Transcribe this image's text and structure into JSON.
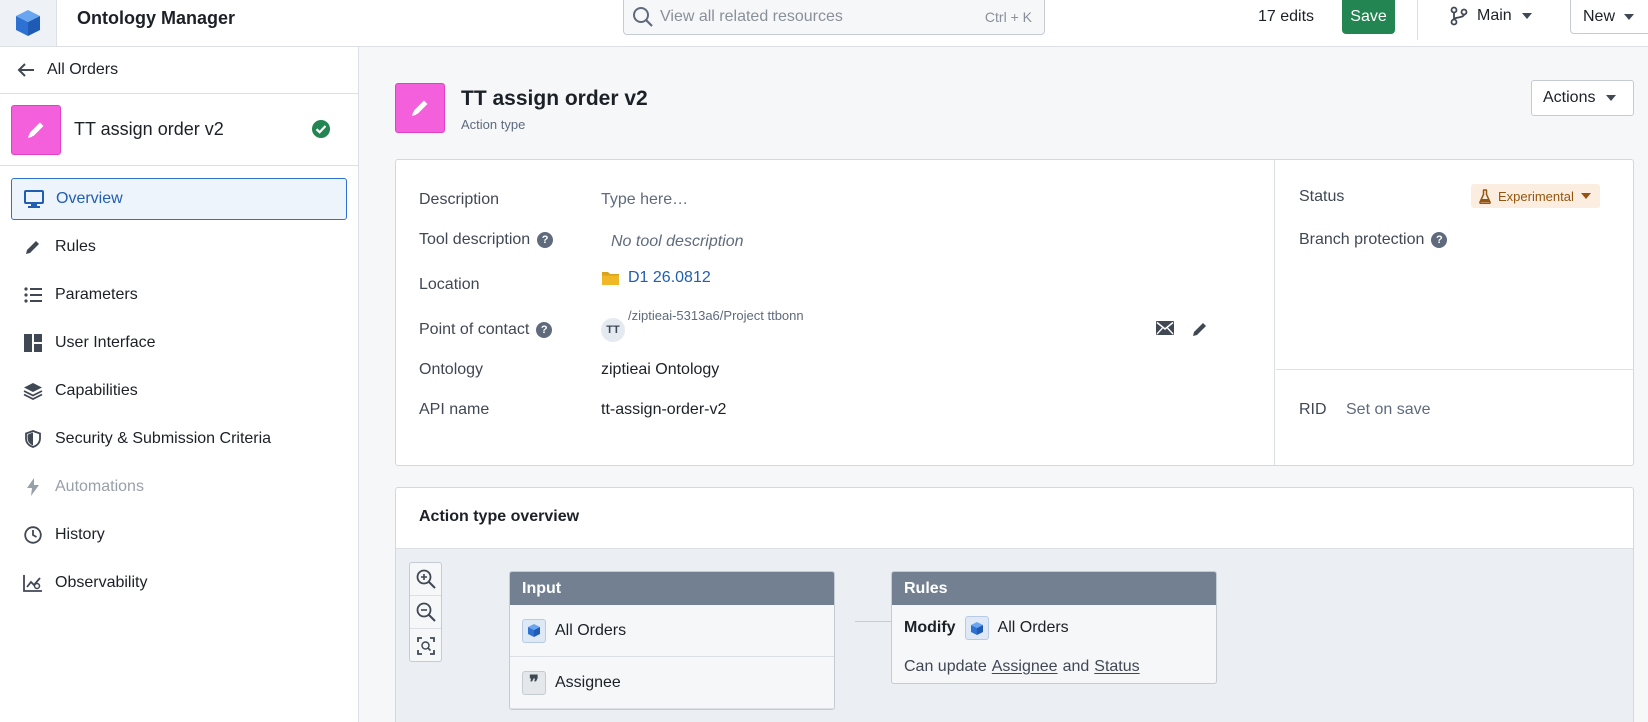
{
  "app": {
    "title": "Ontology Manager",
    "logo_icon": "cube-icon"
  },
  "topbar": {
    "search_placeholder": "View all related resources",
    "search_shortcut": "Ctrl + K",
    "edits": "17 edits",
    "save_label": "Save",
    "branch": "Main",
    "new_label": "New"
  },
  "sidebar": {
    "back_label": "All Orders",
    "entity_name": "TT assign order v2",
    "items": [
      {
        "label": "Overview",
        "icon": "monitor-icon"
      },
      {
        "label": "Rules",
        "icon": "pencil-icon"
      },
      {
        "label": "Parameters",
        "icon": "list-icon"
      },
      {
        "label": "User Interface",
        "icon": "layout-icon"
      },
      {
        "label": "Capabilities",
        "icon": "layers-icon"
      },
      {
        "label": "Security & Submission Criteria",
        "icon": "shield-icon"
      },
      {
        "label": "Automations",
        "icon": "lightning-icon"
      },
      {
        "label": "History",
        "icon": "clock-icon"
      },
      {
        "label": "Observability",
        "icon": "chart-icon"
      }
    ]
  },
  "header": {
    "title": "TT assign order v2",
    "subtitle": "Action type",
    "actions_label": "Actions"
  },
  "properties": {
    "description_label": "Description",
    "description_placeholder": "Type here…",
    "tool_description_label": "Tool description",
    "tool_description_value": "No tool description",
    "location_label": "Location",
    "location_name": "D1 26.0812",
    "location_path": "/ziptieai-5313a6/Project ttbonn",
    "poc_label": "Point of contact",
    "poc_initials": "TT",
    "ontology_label": "Ontology",
    "ontology_value": "ziptieai Ontology",
    "api_label": "API name",
    "api_value": "tt-assign-order-v2"
  },
  "meta": {
    "status_label": "Status",
    "status_value": "Experimental",
    "status_color": "#935610",
    "branch_protection_label": "Branch protection",
    "rid_label": "RID",
    "rid_value": "Set on save"
  },
  "overview": {
    "title": "Action type overview",
    "input_node": {
      "title": "Input",
      "rows": [
        "All Orders",
        "Assignee"
      ]
    },
    "rules_node": {
      "title": "Rules",
      "verb": "Modify",
      "object": "All Orders",
      "can_update": "Can update",
      "field1": "Assignee",
      "and": "and",
      "field2": "Status"
    }
  },
  "colors": {
    "accent": "#2d72d2",
    "save_green": "#238551",
    "entity_pink": "#f45fdb"
  }
}
